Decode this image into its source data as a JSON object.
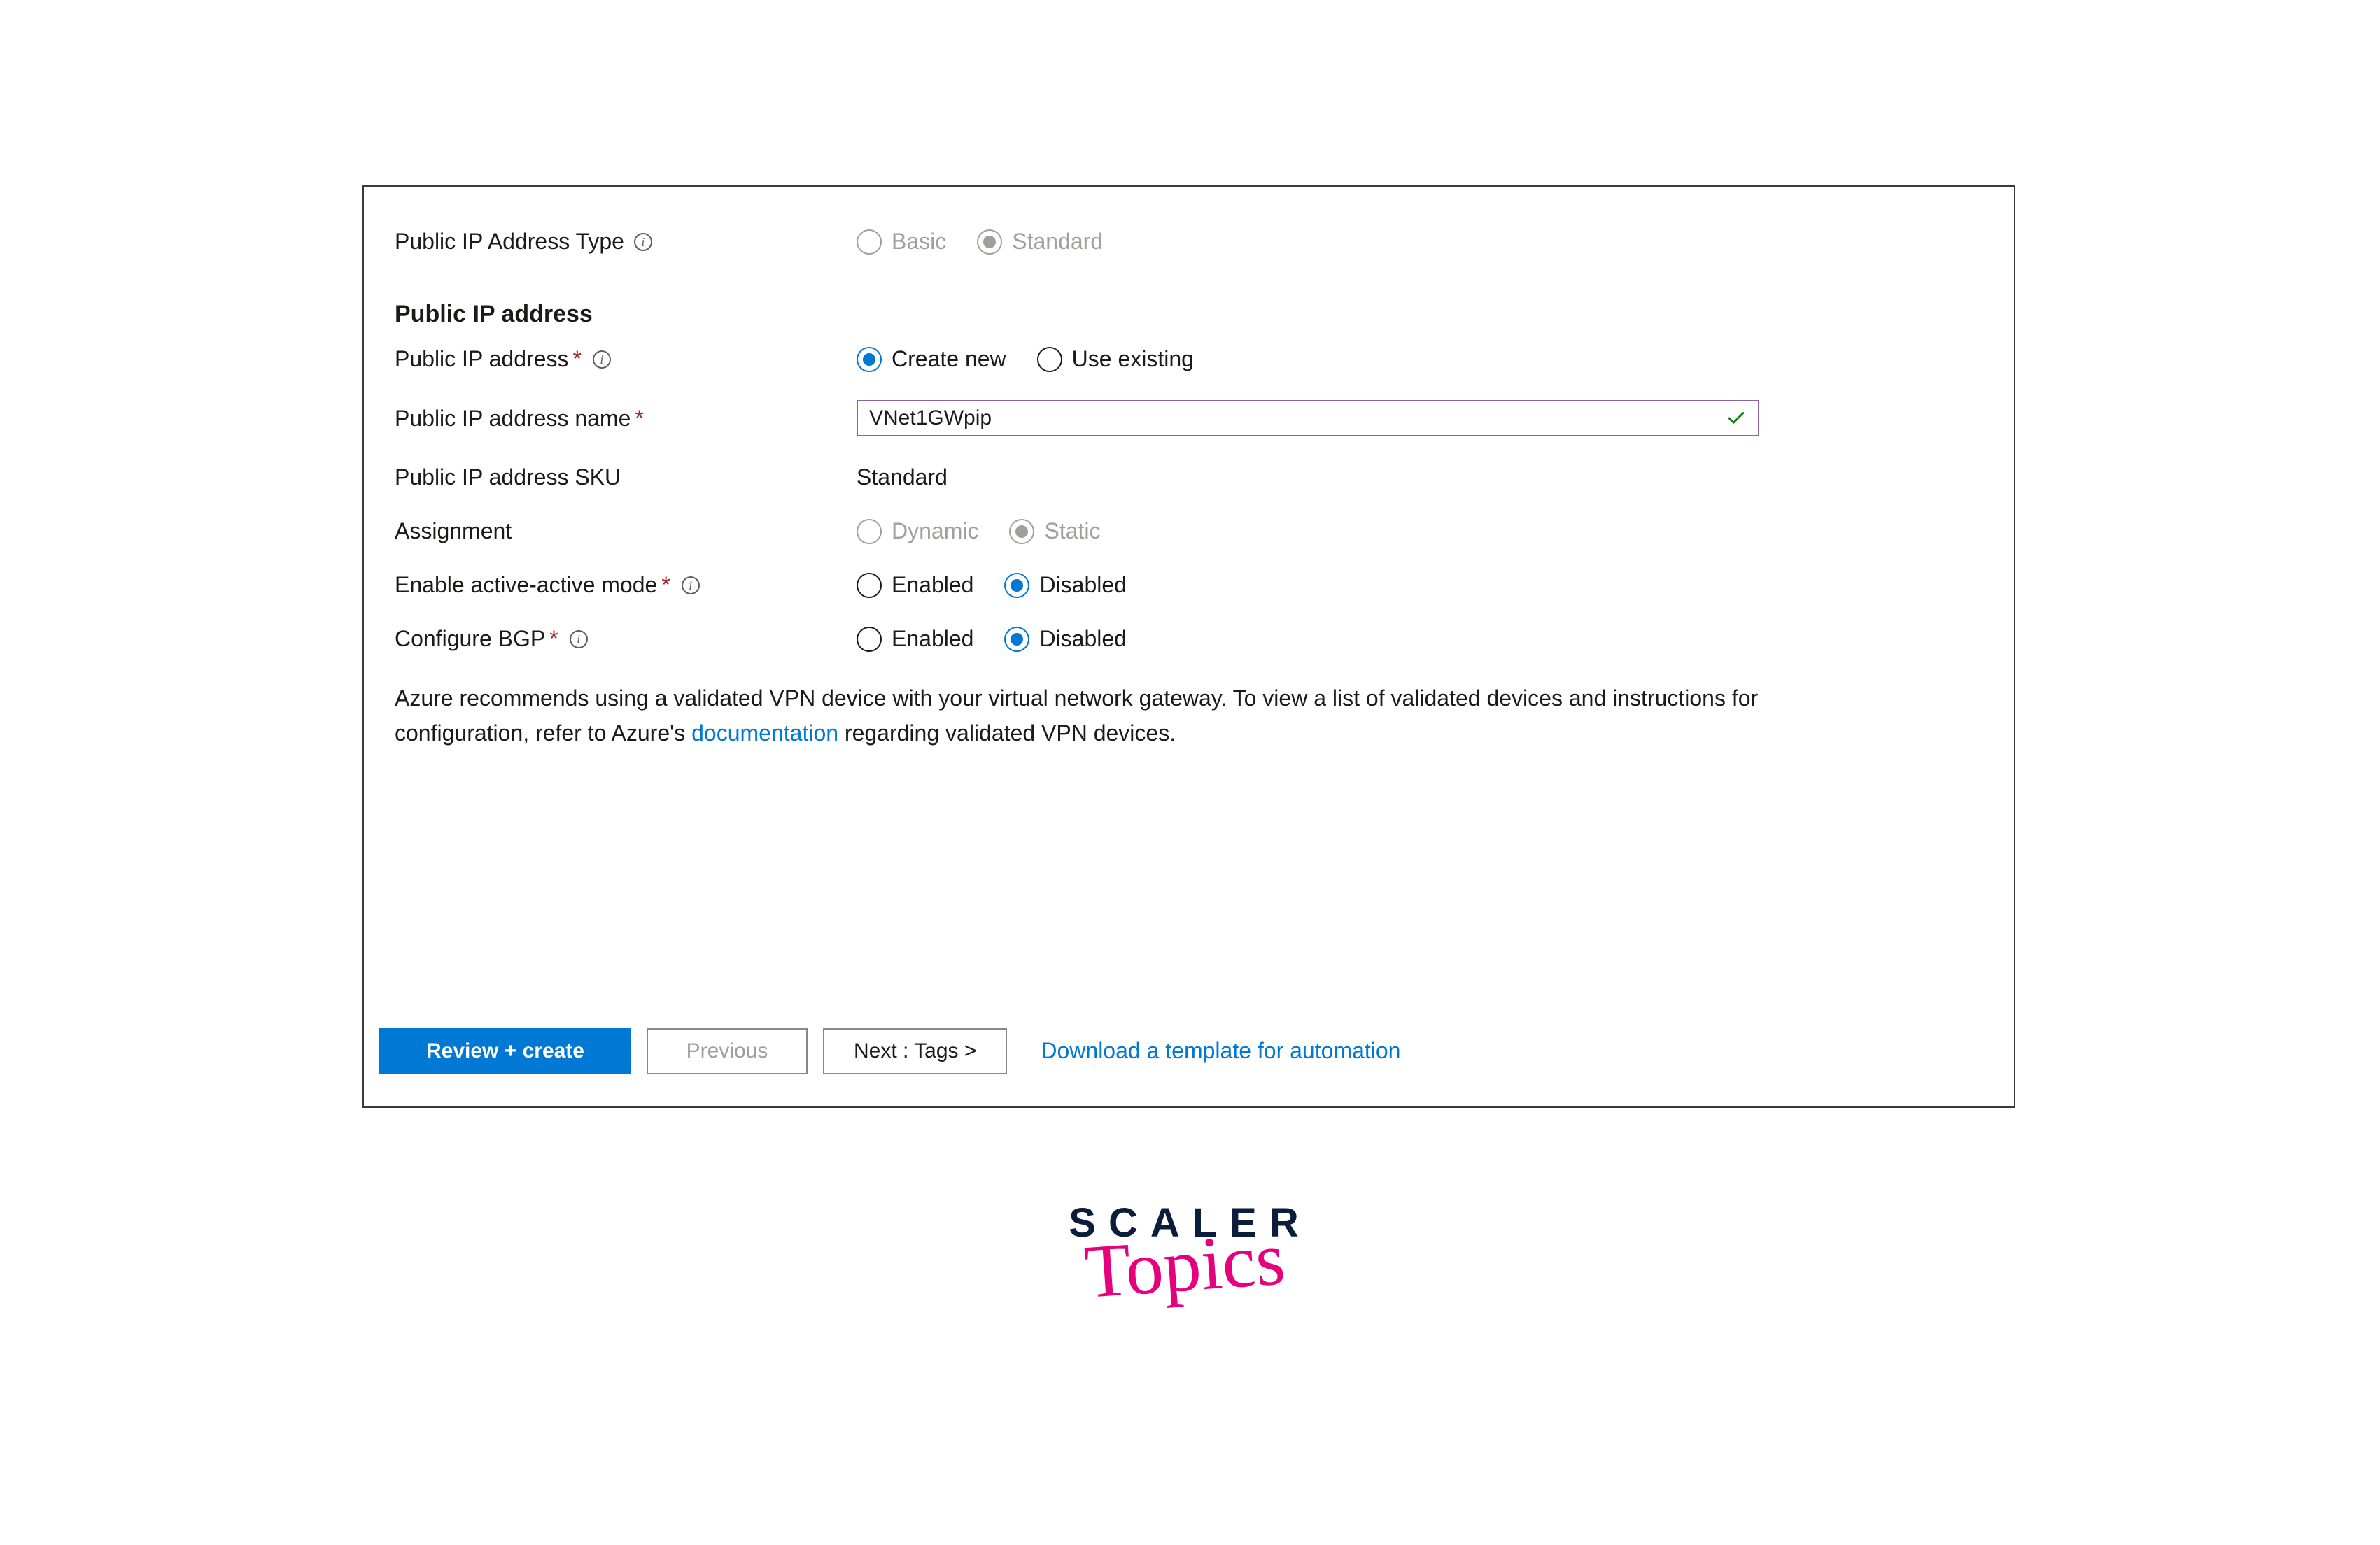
{
  "colors": {
    "accent": "#0078d4",
    "required": "#a4262c",
    "input_border": "#8a64a8",
    "brand_pink": "#e6007e",
    "brand_navy": "#0b1d3a"
  },
  "form": {
    "ip_type": {
      "label": "Public IP Address Type",
      "options": {
        "basic": "Basic",
        "standard": "Standard"
      },
      "selected": "standard",
      "disabled": true
    },
    "section_heading": "Public IP address",
    "ip_address": {
      "label": "Public IP address",
      "options": {
        "create_new": "Create new",
        "use_existing": "Use existing"
      },
      "selected": "create_new"
    },
    "ip_name": {
      "label": "Public IP address name",
      "value": "VNet1GWpip",
      "valid": true
    },
    "ip_sku": {
      "label": "Public IP address SKU",
      "value": "Standard"
    },
    "assignment": {
      "label": "Assignment",
      "options": {
        "dynamic": "Dynamic",
        "static": "Static"
      },
      "selected": "static",
      "disabled": true
    },
    "active_active": {
      "label": "Enable active-active mode",
      "options": {
        "enabled": "Enabled",
        "disabled": "Disabled"
      },
      "selected": "disabled"
    },
    "bgp": {
      "label": "Configure BGP",
      "options": {
        "enabled": "Enabled",
        "disabled": "Disabled"
      },
      "selected": "disabled"
    },
    "note": {
      "pre": "Azure recommends using a validated VPN device with your virtual network gateway. To view a list of validated devices and instructions for configuration, refer to Azure's ",
      "link": "documentation",
      "post": " regarding validated VPN devices."
    }
  },
  "footer": {
    "review_create": "Review + create",
    "previous": "Previous",
    "next": "Next : Tags >",
    "download_template": "Download a template for automation"
  },
  "brand": {
    "line1": "SCALER",
    "line2": "Topics"
  }
}
